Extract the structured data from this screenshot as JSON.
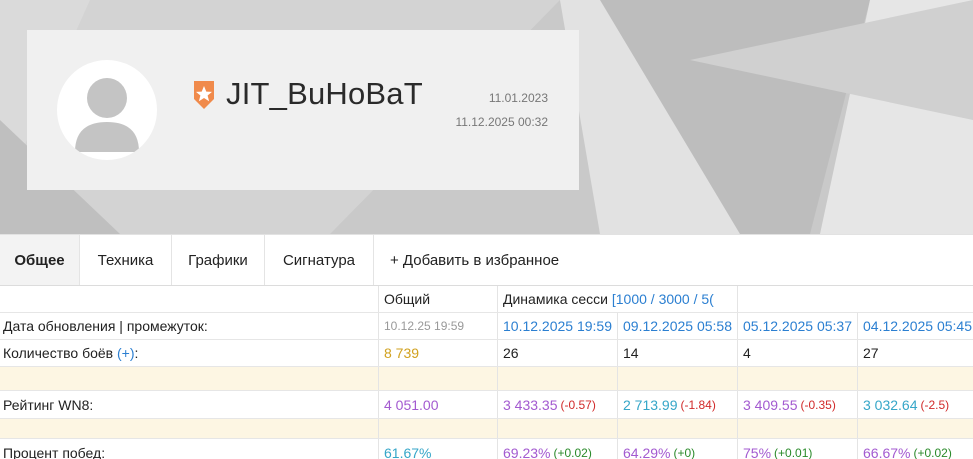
{
  "profile": {
    "nickname": "JIT_BuHoBaT",
    "created_date": "11.01.2023",
    "last_battle": "11.12.2025 00:32"
  },
  "colors": {
    "badge": "#f08a4b",
    "link": "#2b7fd1",
    "wn8_purple": "#a35ad0",
    "winrate_cyan": "#35a6c8",
    "battles_gold": "#d1a11f",
    "spacer": "#fdf6e3"
  },
  "tabs": [
    {
      "label": "Общее",
      "active": true
    },
    {
      "label": "Техника",
      "active": false
    },
    {
      "label": "Графики",
      "active": false
    },
    {
      "label": "Сигнатура",
      "active": false
    },
    {
      "label": "+ Добавить в избранное",
      "active": false
    }
  ],
  "table": {
    "header": {
      "overall": "Общий",
      "dynamics": "Динамика сесси",
      "ranges": "[1000 / 3000 / 5("
    },
    "rows": {
      "update": {
        "label": "Дата обновления | промежуток:",
        "overall": "10.12.25 19:59",
        "sessions": [
          "10.12.2025 19:59",
          "09.12.2025 05:58",
          "05.12.2025 05:37",
          "04.12.2025 05:45"
        ]
      },
      "battles": {
        "label": "Количество боёв",
        "link": "(+)",
        "suffix": ":",
        "overall": "8 739",
        "sessions": [
          "26",
          "14",
          "4",
          "27"
        ]
      },
      "wn8": {
        "label": "Рейтинг WN8:",
        "overall": "4 051.00",
        "sessions": [
          {
            "value": "3 433.35",
            "delta": "(-0.57)"
          },
          {
            "value": "2 713.99",
            "delta": "(-1.84)"
          },
          {
            "value": "3 409.55",
            "delta": "(-0.35)"
          },
          {
            "value": "3 032.64",
            "delta": "(-2.5)"
          }
        ]
      },
      "winrate": {
        "label": "Процент побед:",
        "overall": "61.67%",
        "sessions": [
          {
            "value": "69.23%",
            "delta": "(+0.02)"
          },
          {
            "value": "64.29%",
            "delta": "(+0)"
          },
          {
            "value": "75%",
            "delta": "(+0.01)"
          },
          {
            "value": "66.67%",
            "delta": "(+0.02)"
          }
        ]
      }
    }
  },
  "icons": {
    "avatar": "default-user-avatar-icon",
    "badge": "star-shield-badge-icon"
  }
}
